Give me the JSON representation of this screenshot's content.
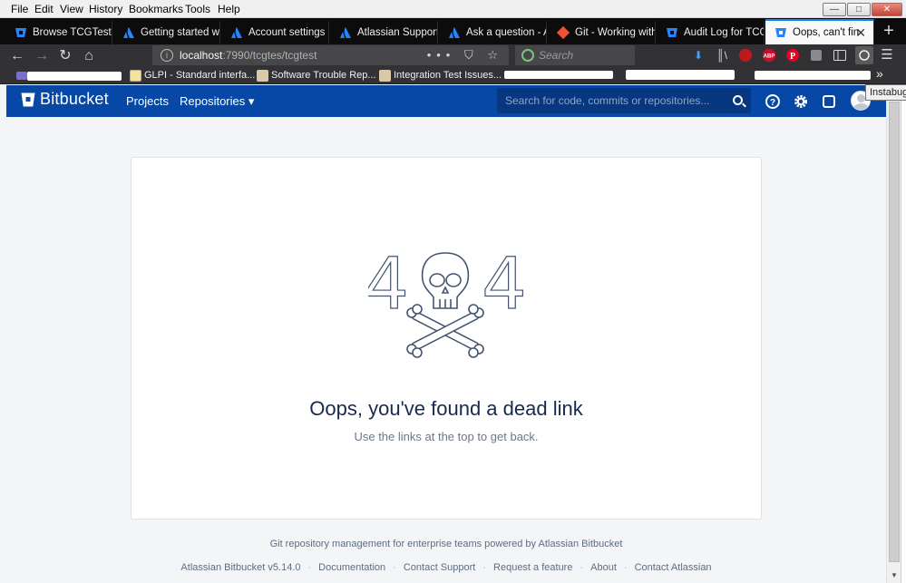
{
  "window": {
    "menu": [
      "File",
      "Edit",
      "View",
      "History",
      "Bookmarks",
      "Tools",
      "Help"
    ],
    "controls": {
      "minimize": "—",
      "maximize": "□",
      "close": "✕"
    }
  },
  "tabs": [
    {
      "label": "Browse TCGTest /",
      "icon": "bitbucket-icon"
    },
    {
      "label": "Getting started wi",
      "icon": "atlassian-icon"
    },
    {
      "label": "Account settings -",
      "icon": "atlassian-icon"
    },
    {
      "label": "Atlassian Support",
      "icon": "atlassian-icon"
    },
    {
      "label": "Ask a question - A",
      "icon": "atlassian-icon"
    },
    {
      "label": "Git - Working with",
      "icon": "git-icon"
    },
    {
      "label": "Audit Log for TCG",
      "icon": "bitbucket-icon"
    },
    {
      "label": "Oops, can't fin",
      "icon": "bitbucket-icon",
      "active": true
    }
  ],
  "navbar": {
    "url_host": "localhost",
    "url_path": ":7990/tcgtes/tcgtest",
    "url_actions": "••• ⛉ ☆",
    "search_placeholder": "Search"
  },
  "bookmarks": [
    {
      "label": "GLPI - Standard interfa...",
      "icon": "glpi-icon"
    },
    {
      "label": "Software Trouble Rep...",
      "icon": "bugzilla-icon"
    },
    {
      "label": "Integration Test Issues...",
      "icon": "bugzilla-icon"
    }
  ],
  "tooltip": "Instabug",
  "bitbucket": {
    "brand": "Bitbucket",
    "nav": [
      "Projects",
      "Repositories ▾"
    ],
    "search_placeholder": "Search for code, commits or repositories..."
  },
  "error": {
    "digit_left": "4",
    "digit_right": "4",
    "title": "Oops, you've found a dead link",
    "subtitle": "Use the links at the top to get back."
  },
  "footer": {
    "tagline": "Git repository management for enterprise teams powered by Atlassian Bitbucket",
    "links": [
      "Atlassian Bitbucket v5.14.0",
      "Documentation",
      "Contact Support",
      "Request a feature",
      "About",
      "Contact Atlassian"
    ]
  },
  "colors": {
    "header": "#0747a6",
    "tab_accent": "#0a84ff",
    "text_dark": "#172b4d"
  }
}
